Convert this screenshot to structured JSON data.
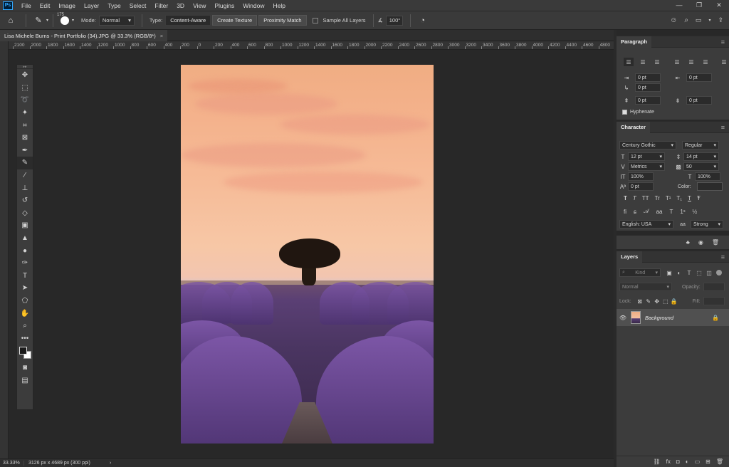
{
  "menubar": {
    "logo": "Ps",
    "items": [
      "File",
      "Edit",
      "Image",
      "Layer",
      "Type",
      "Select",
      "Filter",
      "3D",
      "View",
      "Plugins",
      "Window",
      "Help"
    ],
    "window_controls": [
      "—",
      "❐",
      "✕"
    ]
  },
  "options": {
    "brush_size": "175",
    "mode_label": "Mode:",
    "mode_value": "Normal",
    "type_label": "Type:",
    "type_buttons": [
      "Content-Aware",
      "Create Texture",
      "Proximity Match"
    ],
    "sample_all_layers": "Sample All Layers",
    "angle_value": "100°"
  },
  "document": {
    "tab_title": "Lisa Michele Burns - Print Portfolio (34).JPG @ 33.3% (RGB/8*)",
    "close": "×"
  },
  "ruler": {
    "ticks": [
      "2100",
      "2000",
      "1800",
      "1600",
      "1400",
      "1200",
      "1000",
      "800",
      "600",
      "400",
      "200",
      "0",
      "200",
      "400",
      "600",
      "800",
      "1000",
      "1200",
      "1400",
      "1600",
      "1800",
      "2000",
      "2200",
      "2400",
      "2600",
      "2800",
      "3000",
      "3200",
      "3400",
      "3600",
      "3800",
      "4000",
      "4200",
      "4400",
      "4600",
      "4800",
      "5000"
    ]
  },
  "status": {
    "zoom": "33.33%",
    "dimensions": "3126 px x 4689 px (300 ppi)",
    "arrow": "›"
  },
  "paragraph": {
    "title": "Paragraph",
    "indent_left": "0 pt",
    "indent_right": "0 pt",
    "first_line": "0 pt",
    "space_before": "0 pt",
    "space_after": "0 pt",
    "hyphenate": "Hyphenate"
  },
  "character": {
    "title": "Character",
    "font_family": "Century Gothic",
    "font_style": "Regular",
    "font_size": "12 pt",
    "leading": "14 pt",
    "kerning": "Metrics",
    "tracking": "50",
    "vertical_scale": "100%",
    "horizontal_scale": "100%",
    "baseline_shift": "0 pt",
    "color_label": "Color:",
    "language": "English: USA",
    "aa_label": "aa",
    "antialias": "Strong",
    "style_buttons": [
      "T",
      "T",
      "TT",
      "Tr",
      "T¹",
      "T₁",
      "T",
      "Ŧ"
    ]
  },
  "layers": {
    "title": "Layers",
    "search_placeholder": "Kind",
    "blend_mode": "Normal",
    "opacity_label": "Opacity:",
    "lock_label": "Lock:",
    "fill_label": "Fill:",
    "layer_name": "Background"
  },
  "colors": {
    "accent": "#31a8ff",
    "panel_bg": "#3c3c3c",
    "canvas_bg": "#282828"
  }
}
